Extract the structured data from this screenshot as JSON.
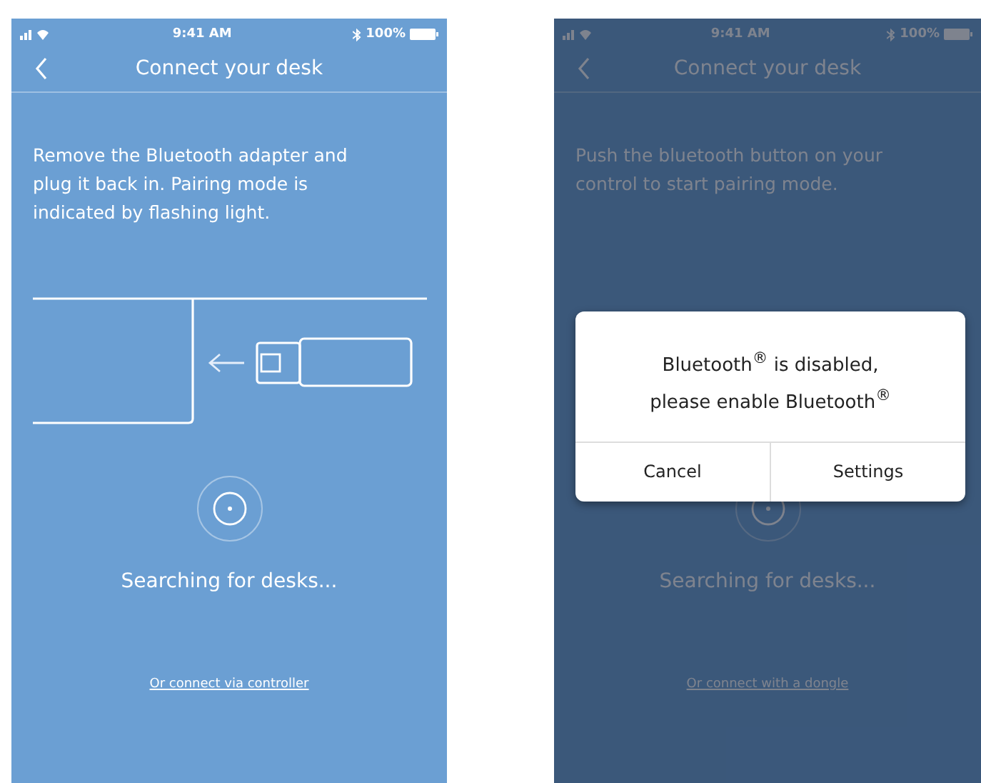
{
  "screens": [
    {
      "status_bar": {
        "time": "9:41 AM",
        "battery": "100%"
      },
      "title": "Connect your desk",
      "instruction": "Remove the Bluetooth adapter and plug it back in. Pairing mode is indicated by flashing light.",
      "adapter_drawing": true,
      "searching": "Searching for desks...",
      "link": "Or connect via controller",
      "dimmed": false
    },
    {
      "status_bar": {
        "time": "9:41 AM",
        "battery": "100%"
      },
      "title": "Connect your desk",
      "instruction": "Push the bluetooth button on your control to start pairing mode.",
      "adapter_drawing": false,
      "searching": "Searching for desks...",
      "link": "Or connect with a dongle",
      "dimmed": true,
      "dialog": {
        "message": [
          "Bluetooth$^{®}$ is disabled,",
          "please enable Bluetooth$^{®}$"
        ],
        "buttons": [
          "Cancel",
          "Settings"
        ]
      }
    }
  ]
}
